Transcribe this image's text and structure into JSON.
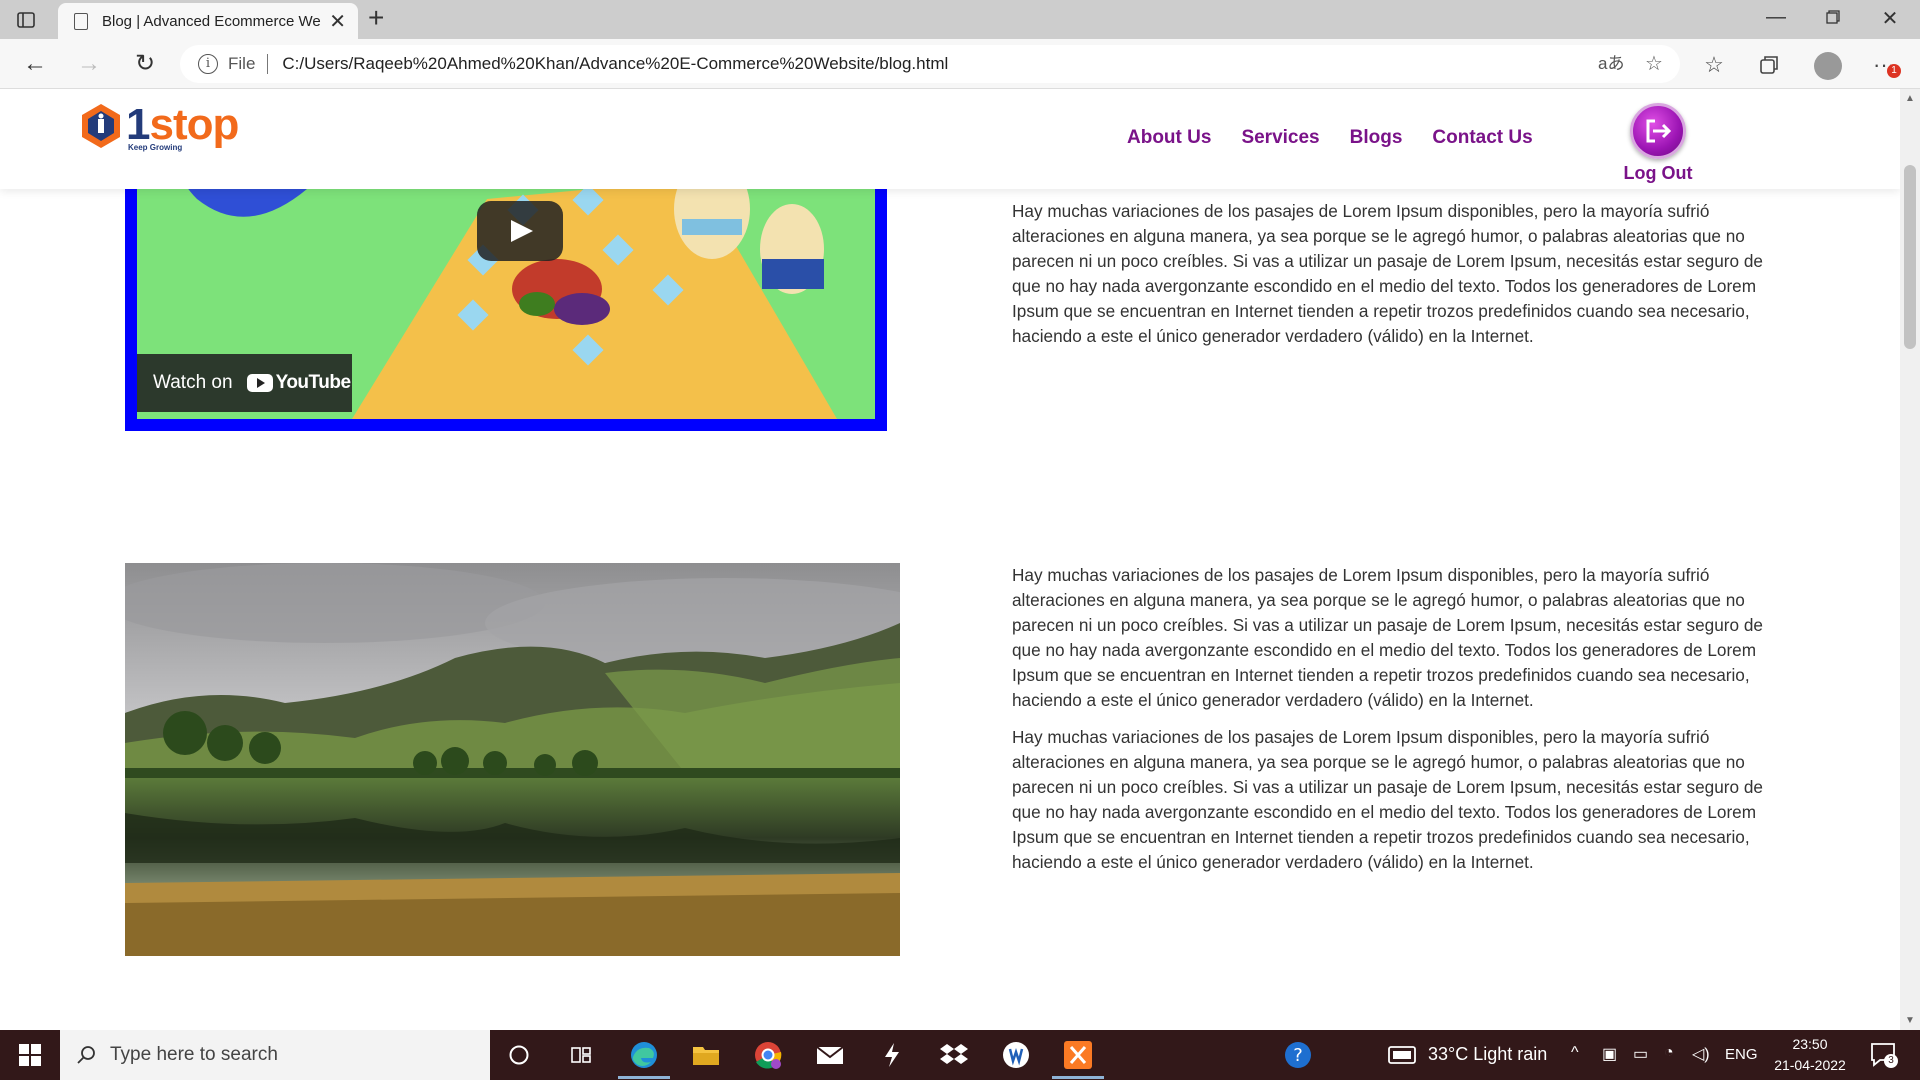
{
  "browser": {
    "tab_title": "Blog | Advanced Ecommerce Website",
    "url_scheme": "File",
    "url": "C:/Users/Raqeeb%20Ahmed%20Khan/Advance%20E-Commerce%20Website/blog.html",
    "notification_count": "1"
  },
  "site": {
    "logo_one": "1",
    "logo_stop": "stop",
    "logo_tagline": "Keep Growing",
    "nav": [
      "About Us",
      "Services",
      "Blogs",
      "Contact Us"
    ],
    "logout_label": "Log Out"
  },
  "video": {
    "watch_on": "Watch on",
    "youtube": "YouTube",
    "frame_color": "#0000ff"
  },
  "sections": {
    "first_text": "Hay muchas variaciones de los pasajes de Lorem Ipsum disponibles, pero la mayoría sufrió alteraciones en alguna manera, ya sea porque se le agregó humor, o palabras aleatorias que no parecen ni un poco creíbles. Si vas a utilizar un pasaje de Lorem Ipsum, necesitás estar seguro de que no hay nada avergonzante escondido en el medio del texto. Todos los generadores de Lorem Ipsum que se encuentran en Internet tienden a repetir trozos predefinidos cuando sea necesario, haciendo a este el único generador verdadero (válido) en la Internet.",
    "second_text_1": "Hay muchas variaciones de los pasajes de Lorem Ipsum disponibles, pero la mayoría sufrió alteraciones en alguna manera, ya sea porque se le agregó humor, o palabras aleatorias que no parecen ni un poco creíbles. Si vas a utilizar un pasaje de Lorem Ipsum, necesitás estar seguro de que no hay nada avergonzante escondido en el medio del texto. Todos los generadores de Lorem Ipsum que se encuentran en Internet tienden a repetir trozos predefinidos cuando sea necesario, haciendo a este el único generador verdadero (válido) en la Internet.",
    "second_text_2": "Hay muchas variaciones de los pasajes de Lorem Ipsum disponibles, pero la mayoría sufrió alteraciones en alguna manera, ya sea porque se le agregó humor, o palabras aleatorias que no parecen ni un poco creíbles. Si vas a utilizar un pasaje de Lorem Ipsum, necesitás estar seguro de que no hay nada avergonzante escondido en el medio del texto. Todos los generadores de Lorem Ipsum que se encuentran en Internet tienden a repetir trozos predefinidos cuando sea necesario, haciendo a este el único generador verdadero (válido) en la Internet."
  },
  "taskbar": {
    "search_placeholder": "Type here to search",
    "weather": "33°C  Light rain",
    "language": "ENG",
    "time": "23:50",
    "date": "21-04-2022",
    "notifications": "3"
  },
  "colors": {
    "nav": "#7a1389",
    "logo_orange": "#f26a1b",
    "logo_blue": "#233b7a",
    "taskbar": "#321819"
  }
}
